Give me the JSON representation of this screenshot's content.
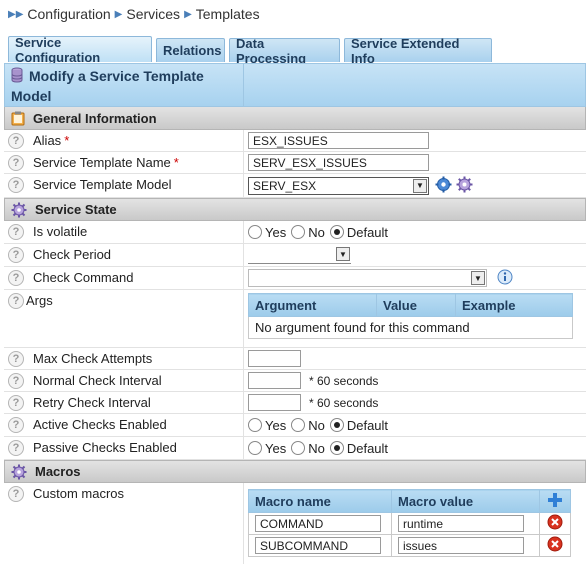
{
  "breadcrumb": {
    "items": [
      "Configuration",
      "Services",
      "Templates"
    ]
  },
  "tabs": [
    {
      "label": "Service Configuration",
      "active": true
    },
    {
      "label": "Relations"
    },
    {
      "label": "Data Processing"
    },
    {
      "label": "Service Extended Info"
    }
  ],
  "form": {
    "title": "Modify a Service Template Model",
    "sections": {
      "general": "General Information",
      "state": "Service State",
      "macros": "Macros"
    },
    "fields": {
      "alias": {
        "label": "Alias",
        "value": "ESX_ISSUES"
      },
      "template_name": {
        "label": "Service Template Name",
        "value": "SERV_ESX_ISSUES"
      },
      "template_model": {
        "label": "Service Template Model",
        "value": "SERV_ESX"
      },
      "is_volatile": {
        "label": "Is volatile"
      },
      "check_period": {
        "label": "Check Period",
        "value": ""
      },
      "check_command": {
        "label": "Check Command",
        "value": ""
      },
      "args": {
        "label": "Args"
      },
      "max_check_attempts": {
        "label": "Max Check Attempts",
        "value": ""
      },
      "normal_check_interval": {
        "label": "Normal Check Interval",
        "value": ""
      },
      "retry_check_interval": {
        "label": "Retry Check Interval",
        "value": ""
      },
      "active_checks": {
        "label": "Active Checks Enabled"
      },
      "passive_checks": {
        "label": "Passive Checks Enabled"
      },
      "custom_macros": {
        "label": "Custom macros"
      }
    },
    "radio": {
      "yes": "Yes",
      "no": "No",
      "default": "Default"
    },
    "interval_suffix": "* 60 seconds",
    "args_table": {
      "headers": [
        "Argument",
        "Value",
        "Example"
      ],
      "empty_message": "No argument found for this command"
    },
    "macro_table": {
      "headers": [
        "Macro name",
        "Macro value"
      ],
      "rows": [
        {
          "name": "COMMAND",
          "value": "runtime"
        },
        {
          "name": "SUBCOMMAND",
          "value": "issues"
        }
      ]
    }
  },
  "icons": [
    "breadcrumb-arrow-icon",
    "database-icon",
    "notepad-icon",
    "gear-icon",
    "help-icon",
    "info-icon",
    "add-icon",
    "delete-icon"
  ],
  "colors": {
    "accent": "#a7d2ef",
    "header_text": "#1f3d5c",
    "delete": "#d9321f",
    "add": "#2f7fd6"
  }
}
